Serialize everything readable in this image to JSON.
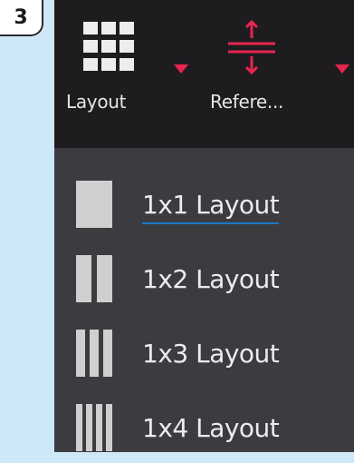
{
  "step_badge": "3",
  "toolbar": {
    "layout_label": "Layout",
    "reference_label": "Refere..."
  },
  "layout_menu": {
    "items": [
      {
        "label": "1x1 Layout",
        "columns": 1,
        "selected": true
      },
      {
        "label": "1x2 Layout",
        "columns": 2,
        "selected": false
      },
      {
        "label": "1x3 Layout",
        "columns": 3,
        "selected": false
      },
      {
        "label": "1x4 Layout",
        "columns": 4,
        "selected": false
      }
    ]
  },
  "colors": {
    "toolbar_bg": "#1e1c1f",
    "dropdown_bg": "#3b3b40",
    "accent_red": "#e8254f",
    "selection_underline": "#1a78c8",
    "page_bg": "#cfe8f8"
  },
  "icons": {
    "layout": "grid-3x3-icon",
    "reference": "reference-lines-icon",
    "dropdown": "caret-down-icon",
    "layout_option": "columns-icon"
  }
}
